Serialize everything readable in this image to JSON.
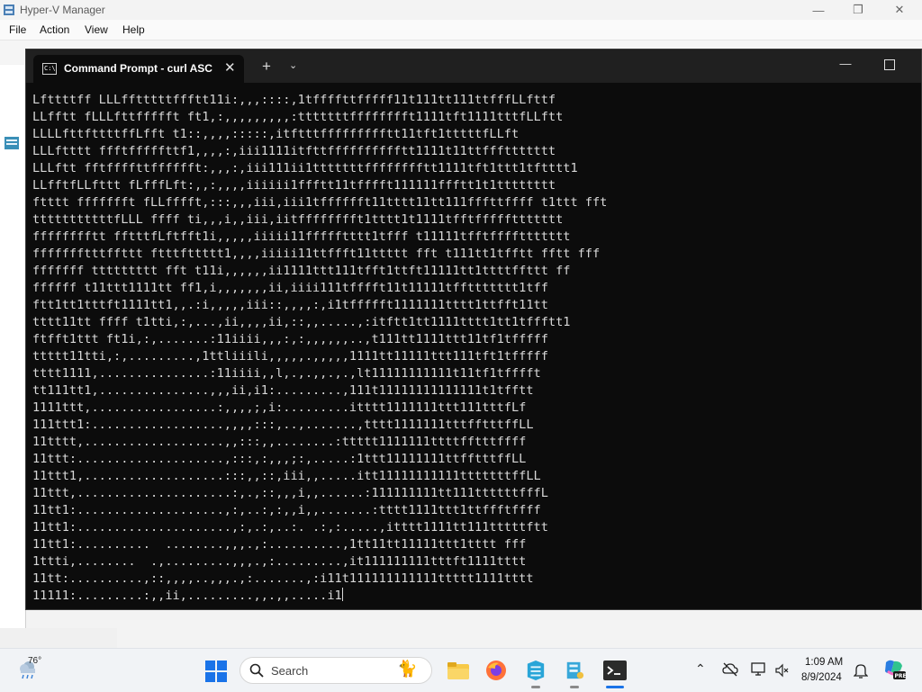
{
  "hyperv": {
    "title": "Hyper-V Manager",
    "menu": [
      "File",
      "Action",
      "View",
      "Help"
    ]
  },
  "terminal": {
    "tab_title": "Command Prompt - curl  ASC",
    "lines": [
      "Lfttttff LLLfftttttffftt11i:,,,::::,1tffffttfffff11t111tt111ttfffLLfttf",
      "LLfftt fLLLfttffffft ft1,:,,,,,,,,,:tttttttfffffffft1111tft1111tttfLLftt",
      "LLLLfttfttttffLfft t1::,,,,:::::,itftttffffffffftt11tft1tttttfLLft",
      "LLLftttt ffftfffffttf1,,,,:,iii1111itfttfffffffffftt1111t11ttfffttttttt",
      "LLLftt fftffffttfffffft:,,,:,iii111ii1tttttttfffffffftt1111tft1ttt1tftttt1",
      "LLfftfLLfttt fLfffLft:,,:,,,,iiiiii1ffftt11tfffft111111ffftt1t1tttttttt",
      "ftttt ffffffft fLLfffft,:::,,,iii,iii1tfffffft11tttt11tt111fffttffff t1ttt fft",
      "tttttttttttfLLL ffff ti,,,i,,iii,iitfffffffft1tttt1t1111tfftfffffttttttt",
      "fffffffftt fftttfLftfft1i,,,,,iiiii11ffffftttt1tfff t11111tfftffffttttttt",
      "ffffffftttffttt ftttfttttt1,,,,iiiii11ttffft11ttttt fft t111tt1tfftt fftt fff",
      "fffffff ttttttttt fft t11i,,,,,,ii1111ttt111tfft1ttft11111tt1ttttffttt ff",
      "ffffff t11ttt1111tt ff1,i,,,,,,,ii,iiii111tfffft11t11111tffttttttt1tff",
      "ftt1tt1tttft1111tt1,,.:i,,,,,iii::,,,,:,i1tffffft1111111tttt1ttfft11tt",
      "tttt11tt ffff t1tti,:,...,ii,,,,ii,::,,.....,:itftt1tt1111tttt1tt1tffftt1",
      "ftfft1ttt ft1i,:,.......:11iiii,,,:,:,,,,,,..,t111tt1111ttt11tf1tfffff",
      "ttttt11tti,:,.........,1ttliiili,,,,,.,,,,,1111tt11111ttt111tft1tfffff",
      "tttt1111,...............:11iiii,,l,.,.,,.,.,lt11111111111t11tf1tfffft",
      "tt111tt1,...............,,,ii,i1:.........,111t11111111111111t1tfftt",
      "1111ttt,.................:,,,,;,i:.........itttt1111111ttt111tttfLf",
      "111ttt1:..................,,,,:::,..,.......,tttt1111111tttfftttffLL",
      "11tttt,...................,,:::,,........:ttttt1111111ttttfftttffff",
      "11ttt:....................,:::,:,,,;:,.....:1ttt11111111ttfftttffLL",
      "11ttt1,...................:::,,::,iii,,.....itt11111111111tttttttffLL",
      "11ttt,.....................:,.,::,,,i,,......:111111111tt111ttttttfffL",
      "11tt1:....................,:,..:,:,,i,,.......:tttt1111ttt1ttffftffff",
      "11tt1:.....................,:,.:,..:. .:,:.....,itttt1111tt111tttttftt",
      "11tt1:..........  ........,,,.,:..........,1tt11tt11111ttt1tttt fff",
      "1ttti,........  .,.........,,,.,:.........,it111111111tttft1111tttt",
      "11tt:..........,::,,,,..,,,.,:.......,:i11t111111111111ttttt1111tttt",
      "11111:.........:,,ii,.........,,.,,.....i1"
    ]
  },
  "taskbar": {
    "weather_temp": "76°",
    "search_label": "Search",
    "clock_time": "1:09 AM",
    "clock_date": "8/9/2024"
  }
}
